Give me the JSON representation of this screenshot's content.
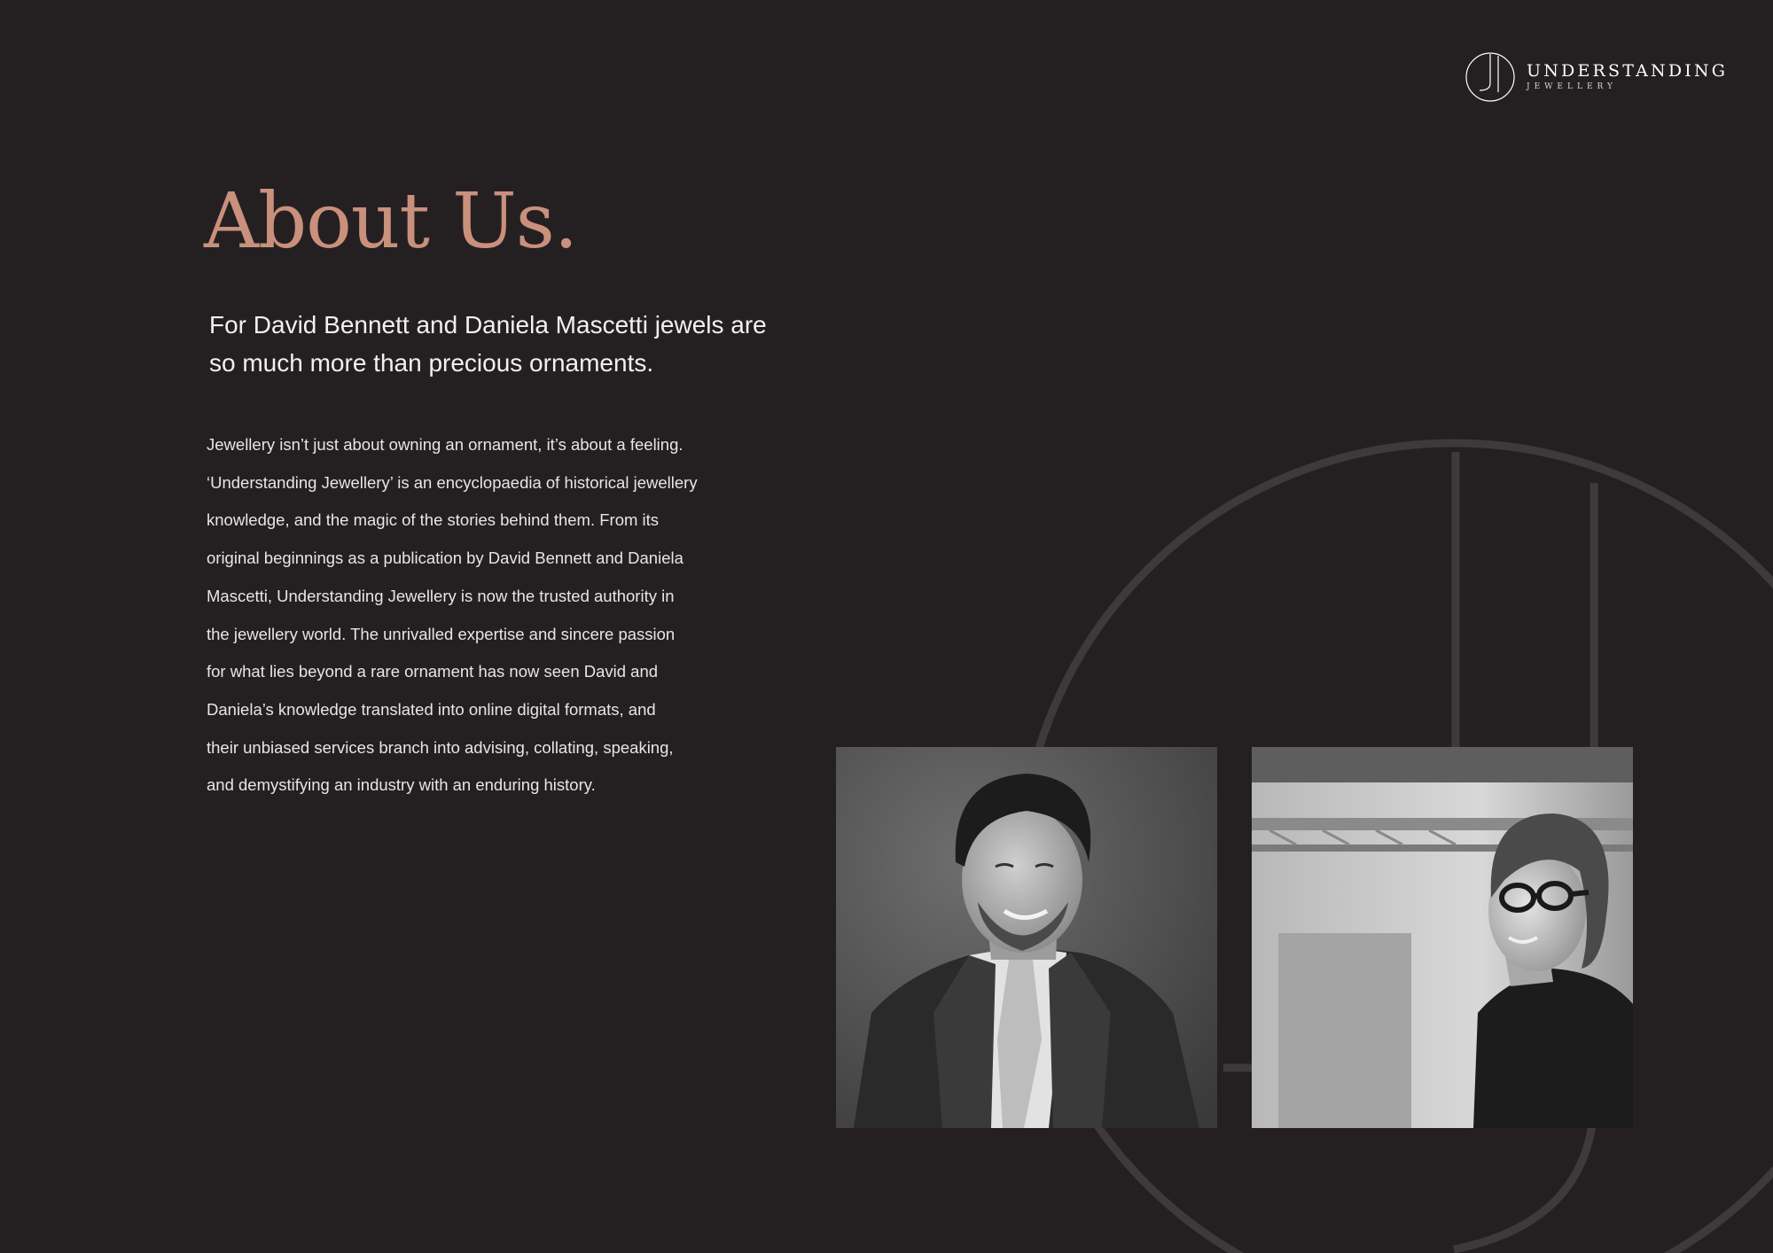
{
  "colors": {
    "background": "#242022",
    "accent": "#c9907c",
    "emblem": "#3e3a3c"
  },
  "logo": {
    "title": "UNDERSTANDING",
    "subtitle": "JEWELLERY",
    "icon": "uj-monogram-icon"
  },
  "heading": "About Us.",
  "intro": "For David Bennett and Daniela Mascetti jewels are so much more than precious ornaments.",
  "body_lines": [
    "Jewellery isn’t just about owning an ornament, it’s about a feeling.",
    "‘Understanding Jewellery’ is an encyclopaedia of historical jewellery",
    "knowledge, and the magic of the stories behind them. From its",
    "original beginnings as a publication by David Bennett and Daniela",
    "Mascetti, Understanding Jewellery is now the trusted authority in",
    "the jewellery world. The unrivalled expertise and sincere passion",
    "for what lies beyond a rare ornament has now seen David and",
    "Daniela’s knowledge translated into online digital formats, and",
    "their unbiased services branch into advising, collating, speaking,",
    "and demystifying an industry with an enduring history."
  ],
  "photos": [
    {
      "subject": "man-in-suit-portrait"
    },
    {
      "subject": "woman-with-glasses-portrait"
    }
  ]
}
